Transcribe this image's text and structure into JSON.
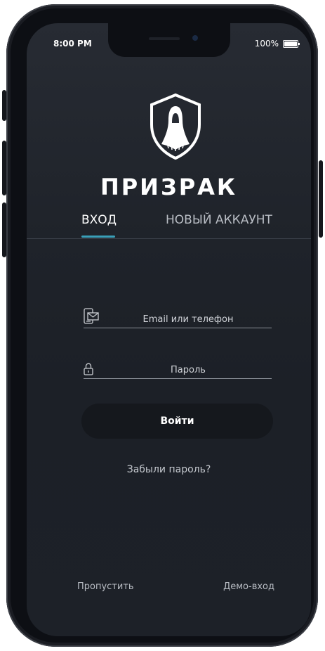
{
  "status_bar": {
    "time": "8:00 PM",
    "battery": "100%"
  },
  "brand": {
    "name": "ПРИЗРАК",
    "icon": "ghost-shield-icon"
  },
  "tabs": [
    {
      "label": "ВХОД",
      "active": true
    },
    {
      "label": "НОВЫЙ АККАУНТ",
      "active": false
    }
  ],
  "form": {
    "email_placeholder": "Email или телефон",
    "email_icon": "phone-mail-icon",
    "password_placeholder": "Пароль",
    "password_icon": "lock-icon",
    "submit_label": "Войти"
  },
  "links": {
    "forgot_password": "Забыли пароль?",
    "skip": "Пропустить",
    "demo_login": "Демо-вход"
  },
  "colors": {
    "accent": "#3a9fb8",
    "background": "#1f232a",
    "button": "#15181d"
  }
}
